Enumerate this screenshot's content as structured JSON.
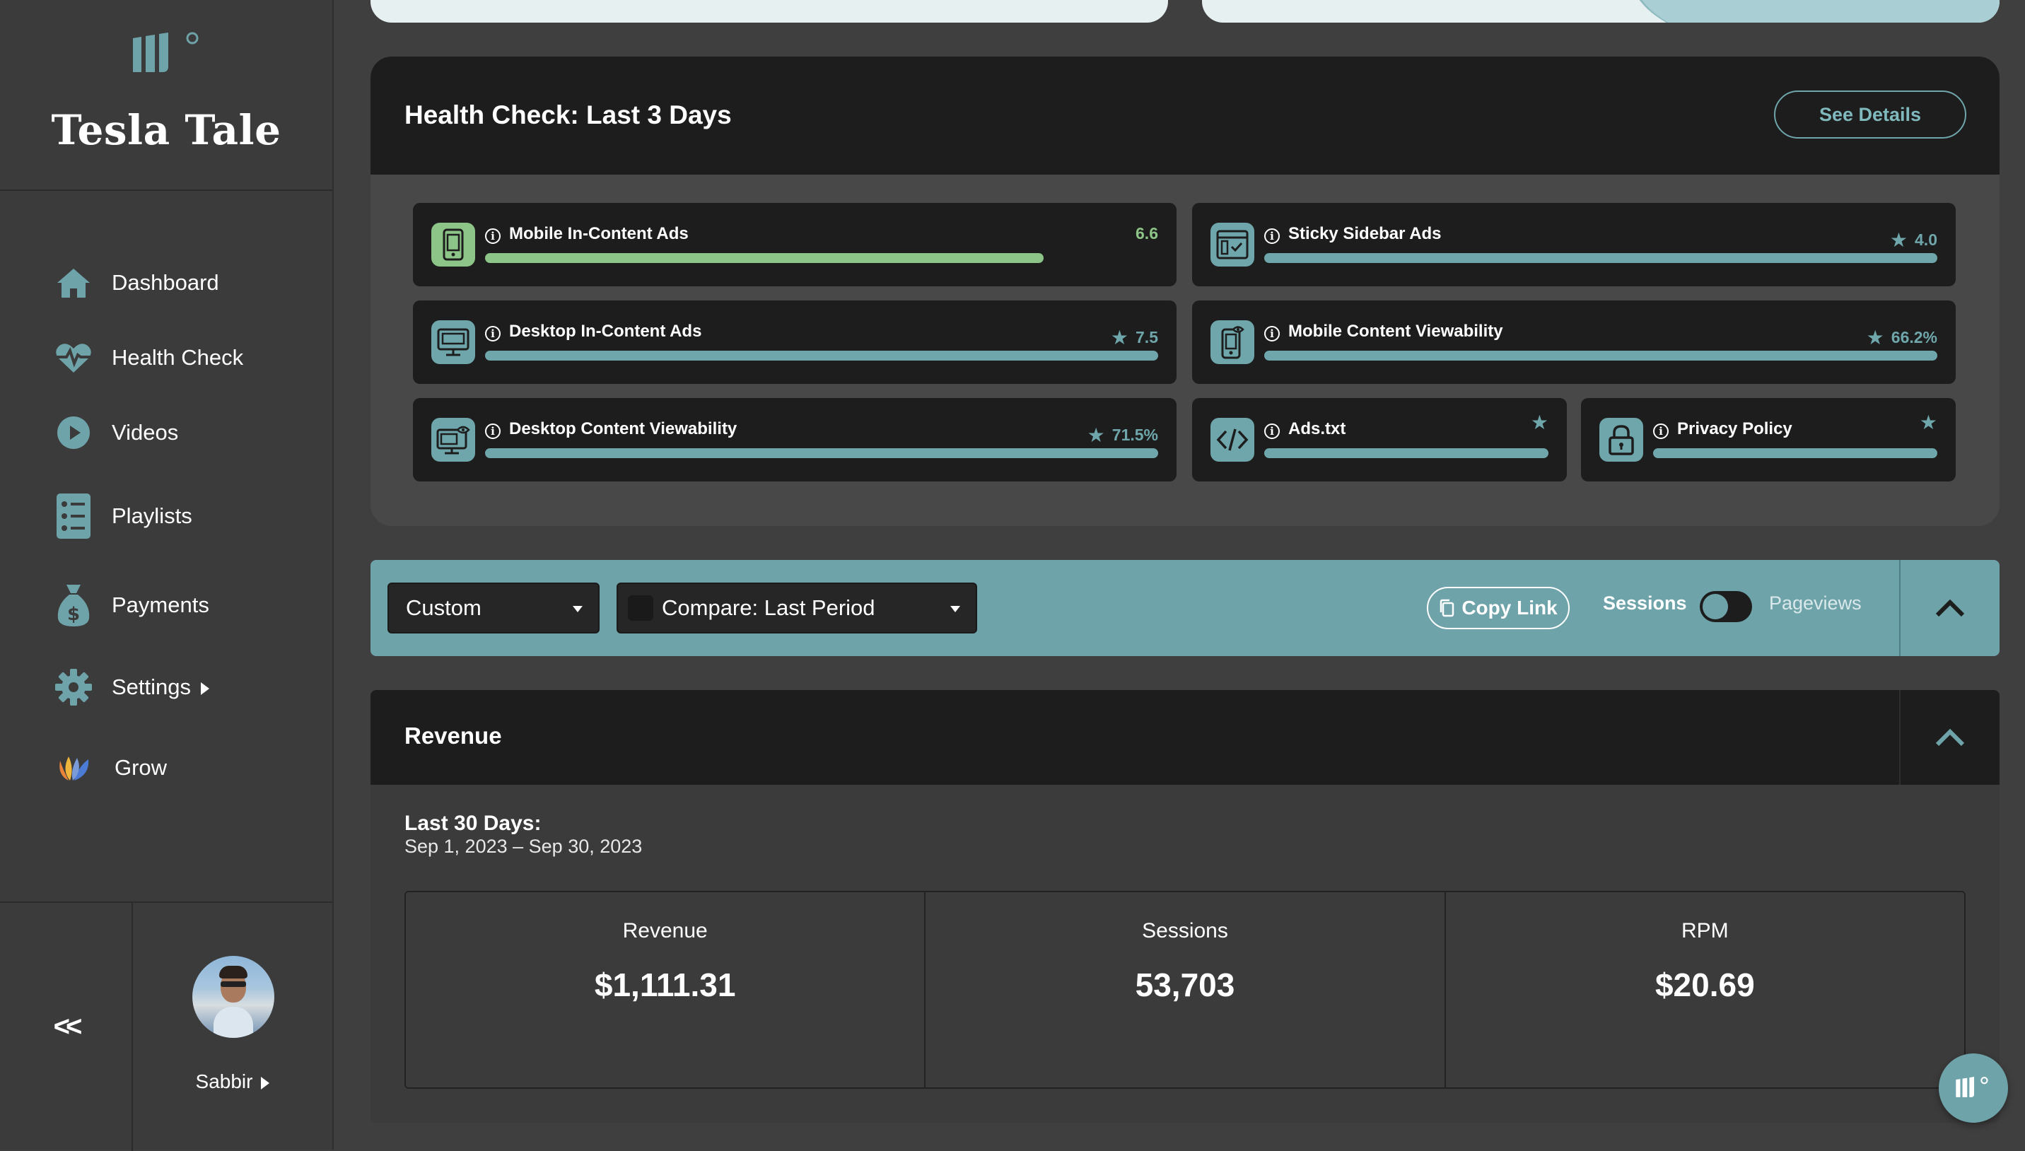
{
  "brand": {
    "name": "Tesla Tale",
    "logo_icon": "brand-logo-icon"
  },
  "sidebar": {
    "items": [
      {
        "label": "Dashboard",
        "icon": "home-icon"
      },
      {
        "label": "Health Check",
        "icon": "heartbeat-icon"
      },
      {
        "label": "Videos",
        "icon": "play-circle-icon"
      },
      {
        "label": "Playlists",
        "icon": "list-icon"
      },
      {
        "label": "Payments",
        "icon": "money-bag-icon"
      },
      {
        "label": "Settings",
        "icon": "gear-icon"
      },
      {
        "label": "Grow",
        "icon": "grow-icon"
      }
    ],
    "collapse_label": "<<",
    "user_name": "Sabbir"
  },
  "health": {
    "title": "Health Check: Last 3 Days",
    "see_details": "See Details",
    "cards": [
      {
        "label": "Mobile In-Content Ads",
        "value": "6.6",
        "progress": 0.83
      },
      {
        "label": "Sticky Sidebar Ads",
        "value": "4.0",
        "progress": 1.0
      },
      {
        "label": "Desktop In-Content Ads",
        "value": "7.5",
        "progress": 1.0
      },
      {
        "label": "Mobile Content Viewability",
        "value": "66.2%",
        "progress": 1.0
      },
      {
        "label": "Desktop Content Viewability",
        "value": "71.5%",
        "progress": 1.0
      },
      {
        "label": "Ads.txt",
        "value": "",
        "progress": 1.0
      },
      {
        "label": "Privacy Policy",
        "value": "",
        "progress": 1.0
      }
    ]
  },
  "filter": {
    "range_select": "Custom",
    "compare_select": "Compare: Last Period",
    "copy_link": "Copy Link",
    "toggle_left": "Sessions",
    "toggle_right": "Pageviews"
  },
  "revenue": {
    "title": "Revenue",
    "period_label": "Last 30 Days:",
    "period_range": "Sep 1, 2023 – Sep 30, 2023",
    "metrics": [
      {
        "label": "Revenue",
        "value": "$1,111.31"
      },
      {
        "label": "Sessions",
        "value": "53,703"
      },
      {
        "label": "RPM",
        "value": "$20.69"
      }
    ]
  },
  "colors": {
    "accent": "#6ea3a9",
    "green": "#8cc587",
    "panel": "#1d1d1d",
    "background": "#3f3f3f"
  }
}
